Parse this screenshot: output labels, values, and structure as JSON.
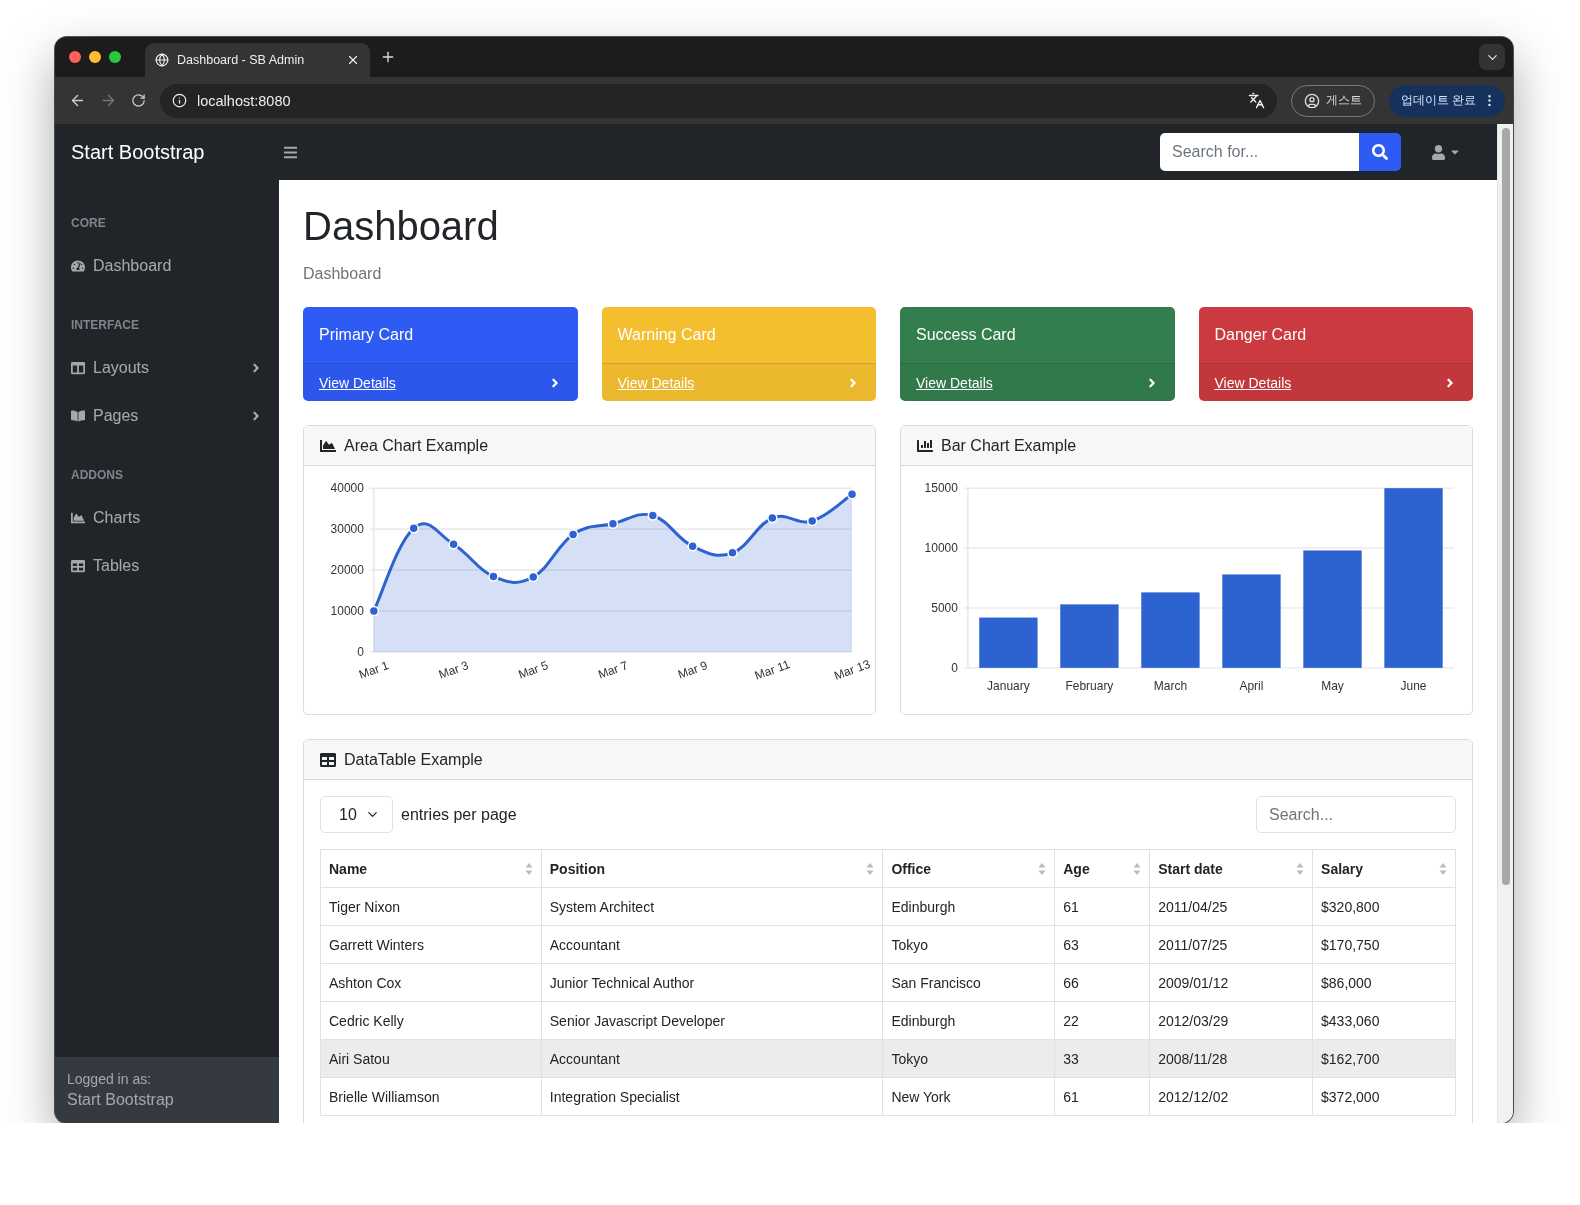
{
  "browser": {
    "tab_title": "Dashboard - SB Admin",
    "url": "localhost:8080",
    "profile_label": "게스트",
    "update_label": "업데이트 완료"
  },
  "navbar": {
    "brand": "Start Bootstrap",
    "search_placeholder": "Search for..."
  },
  "sidebar": {
    "sections": [
      {
        "heading": "CORE",
        "items": [
          {
            "label": "Dashboard",
            "has_submenu": false
          }
        ]
      },
      {
        "heading": "INTERFACE",
        "items": [
          {
            "label": "Layouts",
            "has_submenu": true
          },
          {
            "label": "Pages",
            "has_submenu": true
          }
        ]
      },
      {
        "heading": "ADDONS",
        "items": [
          {
            "label": "Charts",
            "has_submenu": false
          },
          {
            "label": "Tables",
            "has_submenu": false
          }
        ]
      }
    ],
    "footer": {
      "caption": "Logged in as:",
      "name": "Start Bootstrap"
    }
  },
  "page": {
    "title": "Dashboard",
    "breadcrumb": "Dashboard"
  },
  "cards": [
    {
      "title": "Primary Card",
      "link": "View Details",
      "color": "#2f5bf5"
    },
    {
      "title": "Warning Card",
      "link": "View Details",
      "color": "#f4bf2f"
    },
    {
      "title": "Success Card",
      "link": "View Details",
      "color": "#347d4e"
    },
    {
      "title": "Danger Card",
      "link": "View Details",
      "color": "#ca3a3f"
    }
  ],
  "area_chart": {
    "title": "Area Chart Example",
    "chart_data": {
      "type": "area",
      "categories": [
        "Mar 1",
        null,
        "Mar 3",
        null,
        "Mar 5",
        null,
        "Mar 7",
        null,
        "Mar 9",
        null,
        "Mar 11",
        null,
        "Mar 13"
      ],
      "series": [
        {
          "color": "#2c63d1",
          "values": [
            10000,
            30200,
            26300,
            18400,
            18300,
            28700,
            31300,
            33300,
            25800,
            24200,
            32700,
            32000,
            38500
          ]
        }
      ],
      "ylim": [
        0,
        40000
      ],
      "yticks": [
        0,
        10000,
        20000,
        30000,
        40000
      ],
      "grid": true
    }
  },
  "bar_chart": {
    "title": "Bar Chart Example",
    "chart_data": {
      "type": "bar",
      "categories": [
        "January",
        "February",
        "March",
        "April",
        "May",
        "June"
      ],
      "series": [
        {
          "color": "#2c63d1",
          "values": [
            4200,
            5300,
            6300,
            7800,
            9800,
            15000
          ]
        }
      ],
      "ylim": [
        0,
        15000
      ],
      "yticks": [
        0,
        5000,
        10000,
        15000
      ],
      "grid": true
    }
  },
  "table": {
    "title": "DataTable Example",
    "page_size": "10",
    "page_size_label": "entries per page",
    "search_placeholder": "Search...",
    "columns": [
      "Name",
      "Position",
      "Office",
      "Age",
      "Start date",
      "Salary"
    ],
    "rows": [
      {
        "cells": [
          "Tiger Nixon",
          "System Architect",
          "Edinburgh",
          "61",
          "2011/04/25",
          "$320,800"
        ],
        "selected": false
      },
      {
        "cells": [
          "Garrett Winters",
          "Accountant",
          "Tokyo",
          "63",
          "2011/07/25",
          "$170,750"
        ],
        "selected": false
      },
      {
        "cells": [
          "Ashton Cox",
          "Junior Technical Author",
          "San Francisco",
          "66",
          "2009/01/12",
          "$86,000"
        ],
        "selected": false
      },
      {
        "cells": [
          "Cedric Kelly",
          "Senior Javascript Developer",
          "Edinburgh",
          "22",
          "2012/03/29",
          "$433,060"
        ],
        "selected": false
      },
      {
        "cells": [
          "Airi Satou",
          "Accountant",
          "Tokyo",
          "33",
          "2008/11/28",
          "$162,700"
        ],
        "selected": true
      },
      {
        "cells": [
          "Brielle Williamson",
          "Integration Specialist",
          "New York",
          "61",
          "2012/12/02",
          "$372,000"
        ],
        "selected": false
      }
    ]
  }
}
